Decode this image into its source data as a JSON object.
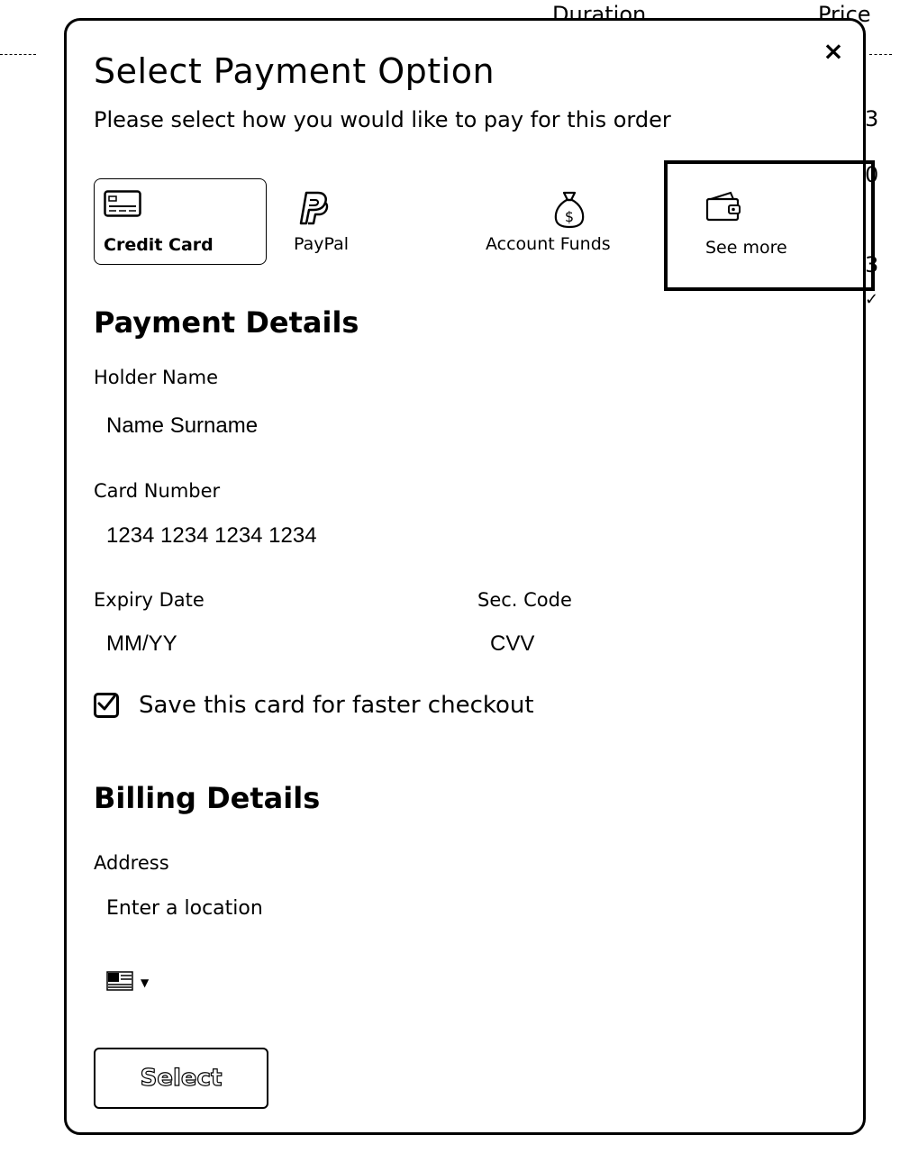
{
  "background": {
    "col_duration": "Duration",
    "col_price": "Price",
    "digits": [
      "3",
      "0",
      "3",
      "✓"
    ]
  },
  "modal": {
    "title": "Select Payment Option",
    "subtitle": "Please select how you would like to pay for this order",
    "close_label": "×"
  },
  "methods": [
    {
      "label": "Credit Card",
      "icon": "credit-card-icon",
      "selected": true
    },
    {
      "label": "PayPal",
      "icon": "paypal-icon"
    },
    {
      "label": "Account Funds",
      "icon": "money-bag-icon"
    },
    {
      "label": "See more",
      "icon": "wallet-icon",
      "focused": true
    }
  ],
  "payment": {
    "title": "Payment Details",
    "holder_label": "Holder Name",
    "holder_placeholder": "Name Surname",
    "card_label": "Card Number",
    "card_placeholder": "1234 1234 1234 1234",
    "expiry_label": "Expiry Date",
    "expiry_placeholder": "MM/YY",
    "sec_label": "Sec. Code",
    "sec_placeholder": "CVV",
    "save_label": "Save this card for faster checkout",
    "save_checked": true
  },
  "billing": {
    "title": "Billing Details",
    "address_label": "Address",
    "address_placeholder": "Enter a location",
    "country_icon": "flag-icon"
  },
  "actions": {
    "select_label": "Select"
  }
}
